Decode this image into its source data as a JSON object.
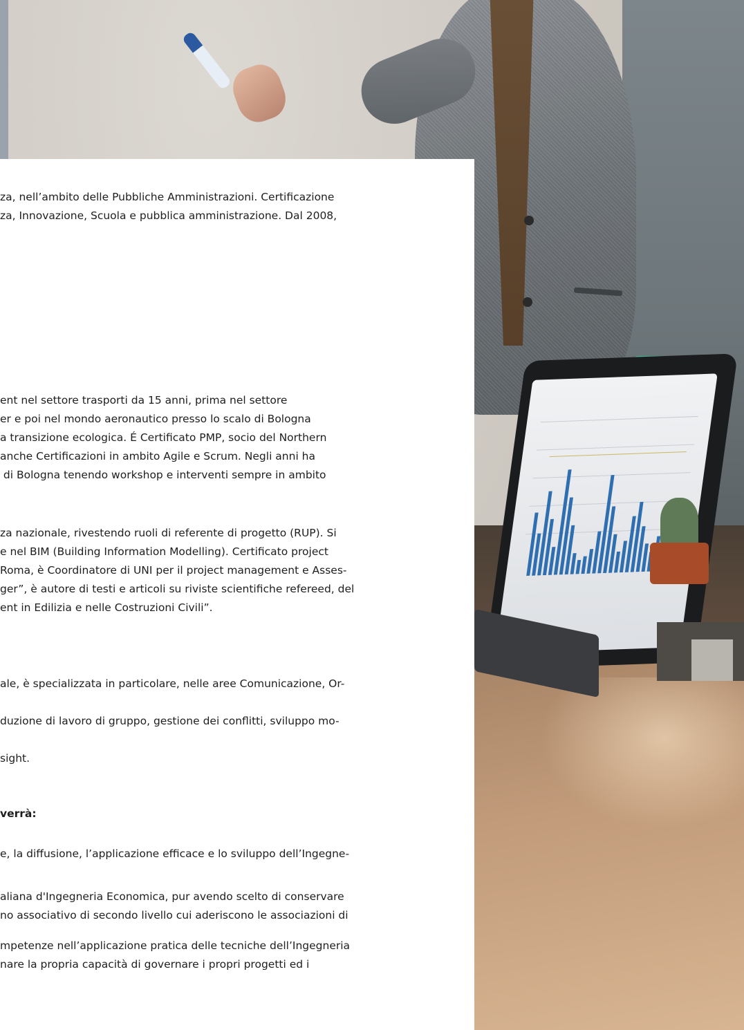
{
  "paragraphs": [
    {
      "lines": [
        "za, nell’ambito delle Pubbliche Amministrazioni. Certificazione",
        "za, Innovazione, Scuola e pubblica amministrazione. Dal 2008,"
      ]
    },
    {
      "lines": [
        "ent nel settore trasporti da 15 anni, prima nel settore",
        "er e poi nel mondo aeronautico presso lo scalo di Bologna",
        "a transizione ecologica. É Certificato PMP, socio del Northern",
        "anche Certificazioni in ambito Agile e Scrum. Negli anni ha",
        " di Bologna tenendo workshop e interventi sempre in ambito"
      ]
    },
    {
      "lines": [
        "za nazionale, rivestendo ruoli di referente di progetto (RUP). Si",
        "e nel BIM (Building Information Modelling). Certificato project",
        "Roma, è Coordinatore di UNI per il project management e Asses-",
        "ger”, è autore di testi e articoli su riviste scientifiche refereed, del",
        "ent in Edilizia e nelle Costruzioni Civili”."
      ]
    },
    {
      "lines": [
        "ale, è specializzata in particolare, nelle aree Comunicazione, Or-"
      ]
    },
    {
      "lines": [
        "duzione di lavoro di gruppo, gestione dei conflitti, sviluppo mo-"
      ]
    },
    {
      "lines": [
        "sight."
      ]
    },
    {
      "lines": [
        "verrà:"
      ],
      "bold": true
    },
    {
      "lines": [
        "e, la diffusione, l’applicazione efficace e lo sviluppo dell’Ingegne-"
      ]
    },
    {
      "lines": [
        "aliana d'Ingegneria Economica, pur avendo scelto di conservare",
        "no associativo di secondo livello cui aderiscono le associazioni di"
      ]
    },
    {
      "lines": [
        "mpetenze nell’applicazione pratica delle tecniche dell’Ingegneria",
        "nare la propria capacità di governare i propri progetti ed i"
      ]
    }
  ],
  "photo": {
    "subject": "presenter-with-marker",
    "accent_colors": {
      "marker": "#2c5aa0",
      "chart_bars": "#2f6fb0",
      "cup": "#3fb596",
      "pot": "#a84b28"
    }
  }
}
